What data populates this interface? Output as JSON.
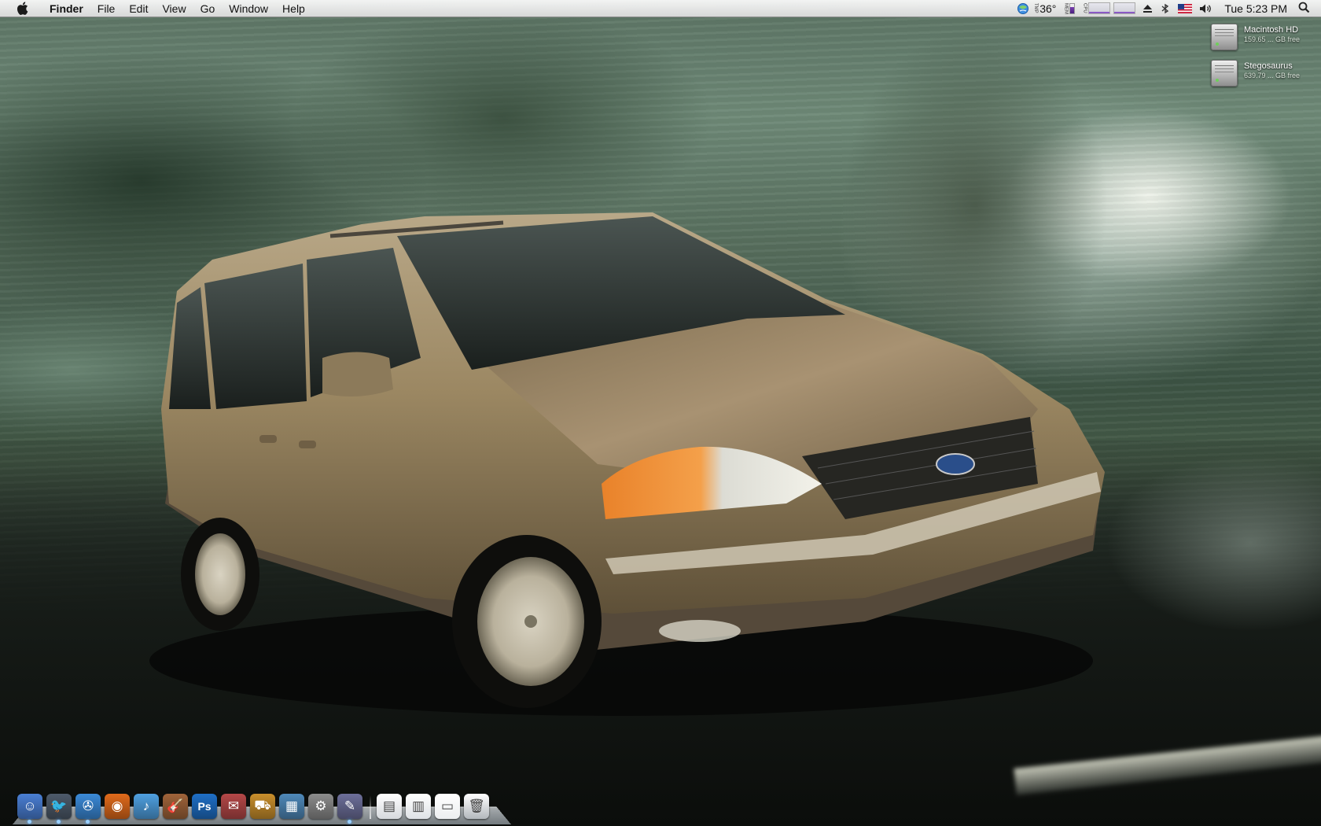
{
  "menubar": {
    "app_name": "Finder",
    "menus": [
      "File",
      "Edit",
      "View",
      "Go",
      "Window",
      "Help"
    ],
    "status": {
      "weather_temp": "36°",
      "temp_label": "TMP",
      "mem_label": "MEM",
      "cpu_label": "CPU",
      "clock": "Tue 5:23 PM"
    }
  },
  "desktop": {
    "volumes": [
      {
        "name": "Macintosh HD",
        "free": "159.65 ... GB free"
      },
      {
        "name": "Stegosaurus",
        "free": "639.79 ... GB free"
      }
    ]
  },
  "dock": {
    "apps": [
      {
        "name": "finder-icon",
        "glyph": "☺",
        "color": "#4a7fd4",
        "running": true
      },
      {
        "name": "bird-icon",
        "glyph": "🐦",
        "color": "#4d5a6a",
        "running": true
      },
      {
        "name": "safari-icon",
        "glyph": "✇",
        "color": "#3b8ad8",
        "running": true
      },
      {
        "name": "firefox-icon",
        "glyph": "◉",
        "color": "#e06a1b",
        "running": false
      },
      {
        "name": "itunes-icon",
        "glyph": "♪",
        "color": "#4fa0e0",
        "running": false
      },
      {
        "name": "garageband-icon",
        "glyph": "🎸",
        "color": "#a0643a",
        "running": false
      },
      {
        "name": "photoshop-icon",
        "glyph": "Ps",
        "color": "#1f6fc6",
        "running": false
      },
      {
        "name": "preview-icon",
        "glyph": "✉",
        "color": "#b54848",
        "running": false
      },
      {
        "name": "truck-app-icon",
        "glyph": "⛟",
        "color": "#c98f2c",
        "running": false
      },
      {
        "name": "keynote-icon",
        "glyph": "▦",
        "color": "#4f89b9",
        "running": false
      },
      {
        "name": "system-preferences-icon",
        "glyph": "⚙",
        "color": "#8c8c8c",
        "running": false
      },
      {
        "name": "script-editor-icon",
        "glyph": "✎",
        "color": "#6d6f9a",
        "running": true
      }
    ],
    "docs": [
      {
        "name": "applications-stack-icon",
        "glyph": "▤",
        "color": "#d6d9dd"
      },
      {
        "name": "documents-stack-icon",
        "glyph": "▥",
        "color": "#dfe2e6"
      },
      {
        "name": "downloads-stack-icon",
        "glyph": "▭",
        "color": "#eceef0"
      },
      {
        "name": "trash-icon",
        "glyph": "🗑",
        "color": "#b3b8bd"
      }
    ]
  }
}
